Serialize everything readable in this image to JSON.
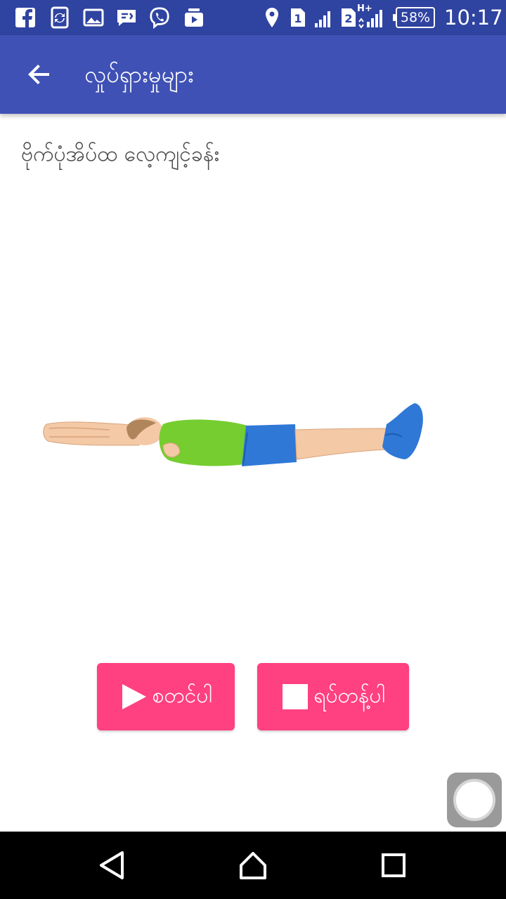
{
  "status_bar": {
    "battery_percent": "58%",
    "time": "10:17",
    "sim1": "1",
    "sim2": "2",
    "network_type": "H+",
    "icons": [
      "facebook-icon",
      "sync-app-icon",
      "gallery-icon",
      "message-icon",
      "viber-icon",
      "media-icon",
      "location-icon",
      "sim1-icon",
      "signal1-icon",
      "sim2-icon",
      "signal2-icon",
      "battery-icon"
    ]
  },
  "app_bar": {
    "title": "လှုပ်ရှားမှုများ",
    "back_icon": "arrow-back-icon"
  },
  "exercise": {
    "name": "ဗိုက်ပုံအိပ်ထ လေ့ကျင့်ခန်း"
  },
  "buttons": {
    "start_label": "စတင်ပါ",
    "start_icon": "play-icon",
    "stop_label": "ရပ်တန့်ပါ",
    "stop_icon": "stop-icon"
  },
  "colors": {
    "status_bar": "#2f43a0",
    "app_bar": "#3f51b5",
    "accent": "#ff4081",
    "text": "#4a4a4a"
  },
  "nav_bar": {
    "icons": [
      "back-triangle-icon",
      "home-icon",
      "recents-icon"
    ]
  }
}
